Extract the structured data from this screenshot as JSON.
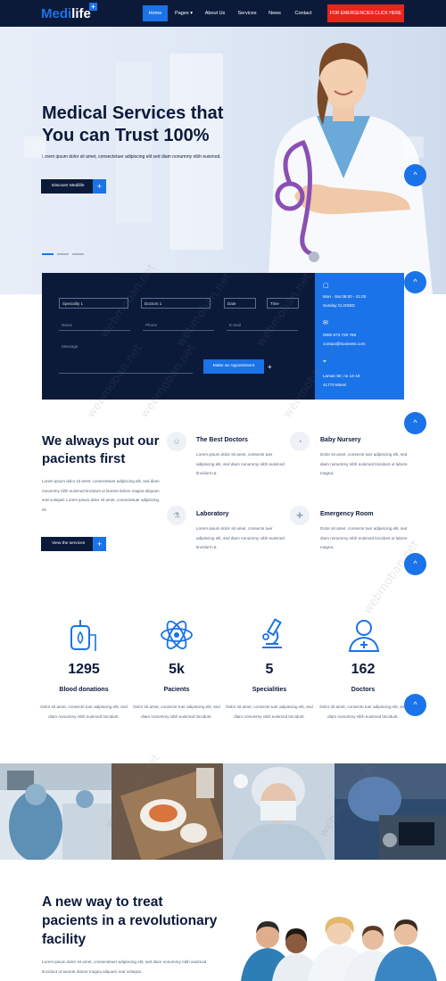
{
  "header": {
    "logo_a": "Medi",
    "logo_b": "life",
    "logo_plus": "+",
    "nav": [
      "Home",
      "Pages",
      "About Us",
      "Services",
      "News",
      "Contact"
    ],
    "cta": "FOR EMERGENCIES CLICK HERE"
  },
  "hero": {
    "title": "Medical Services that You can Trust 100%",
    "text": "Lorem ipsum dolor sit amet, consectetuer adipiscing elit sed diam nonummy nibh euismod.",
    "button": "Discover Medilife",
    "button_plus": "+",
    "arrow_left": "‹",
    "arrow_right": "›"
  },
  "fab": {
    "icon": "^"
  },
  "appointment": {
    "speciality": "Speciality 1",
    "doctors": "Doctors 1",
    "date": "Date",
    "time": "Time",
    "name": "Name",
    "phone": "Phone",
    "email": "E-mail",
    "message": "Message",
    "button": "Make an Appointment",
    "plus": "+",
    "hours_line1": "Mon - Sat 08:00 - 21:00",
    "hours_line2": "Sunday CLOSED",
    "phone_number": "0080 673 729 766",
    "email_address": "contact@business.com",
    "address_line1": "Lamas Str, no 14-18",
    "address_line2": "41770 Miami"
  },
  "why": {
    "title": "We always put our pacients first",
    "text": "Lorem ipsum dolor sit amet, consectetuer adipiscing elit, sed diam nonummy nibh euismod tincidunt ut laoreet dolore magna aliquam erat volutpat. Lorem ipsum dolor sit amet, consectetuer adipiscing eli.",
    "button": "View the services",
    "button_plus": "+",
    "services": [
      {
        "title": "The Best Doctors",
        "text": "Lorem ipsum dolor sit amet, consecte tuer adipiscing elit, sed diam nonummy nibh euismod tincidunt ut."
      },
      {
        "title": "Baby Nursery",
        "text": "Dolor sit amet, consecte tuer adipiscing elit, sed diam nonummy nibh euismod tincidunt ut labore magna."
      },
      {
        "title": "Laboratory",
        "text": "Lorem ipsum dolor sit amet, consecte tuer adipiscing elit, sed diam nonummy nibh euismod tincidunt ut."
      },
      {
        "title": "Emergency Room",
        "text": "Dolor sit amet, consecte tuer adipiscing elit, sed diam nonummy nibh euismod tincidunt ut labore magna."
      }
    ]
  },
  "stats": [
    {
      "number": "1295",
      "label": "Blood donations",
      "text": "Dolor sit amet, consecte tuer adipiscing elit, sed diam nonummy nibh euismod tincidunt.",
      "icon": "blood-bag-icon"
    },
    {
      "number": "5k",
      "label": "Pacients",
      "text": "Dolor sit amet, consecte tuer adipiscing elit, sed diam nonummy nibh euismod tincidunt.",
      "icon": "atom-icon"
    },
    {
      "number": "5",
      "label": "Specialities",
      "text": "Dolor sit amet, consecte tuer adipiscing elit, sed diam nonummy nibh euismod tincidunt.",
      "icon": "microscope-icon"
    },
    {
      "number": "162",
      "label": "Doctors",
      "text": "Dolor sit amet, consecte tuer adipiscing elit, sed diam nonummy nibh euismod tincidunt.",
      "icon": "doctor-icon"
    }
  ],
  "new_way": {
    "title": "A new way to treat pacients in a revolutionary facility",
    "text": "Lorem ipsum dolor sit amet, consectetuer adipiscing elit, sed diam nonummy nibh euismod tincidunt ut laoreet dolore magna aliquam erat volutpat."
  },
  "watermark": "webmoban.net",
  "colors": {
    "navy": "#0c1a3a",
    "blue": "#1a73e8",
    "red": "#e8251d"
  }
}
